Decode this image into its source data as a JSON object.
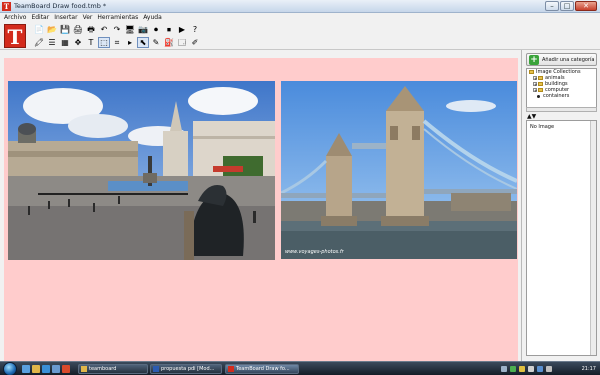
{
  "window": {
    "title": "TeamBoard Draw food.tmb *",
    "controls": {
      "minimize": "–",
      "maximize": "□",
      "close": "✕"
    }
  },
  "menu": [
    "Archivo",
    "Editar",
    "Insertar",
    "Ver",
    "Herramientas",
    "Ayuda"
  ],
  "toolbar": {
    "logo_letter": "T",
    "row1": [
      {
        "icon": "new-file-icon",
        "glyph": "📄"
      },
      {
        "icon": "open-folder-icon",
        "glyph": "📂"
      },
      {
        "icon": "save-icon",
        "glyph": "💾"
      },
      {
        "icon": "print-icon",
        "glyph": "🖨"
      },
      {
        "icon": "print-preview-icon",
        "glyph": "🖶"
      },
      {
        "icon": "undo-icon",
        "glyph": "↶"
      },
      {
        "icon": "redo-icon",
        "glyph": "↷"
      },
      {
        "icon": "monitor-icon",
        "glyph": "🖥"
      },
      {
        "icon": "camera-icon",
        "glyph": "📷"
      },
      {
        "icon": "record-icon",
        "glyph": "⏺"
      },
      {
        "icon": "stop-icon",
        "glyph": "⏹"
      },
      {
        "icon": "play-icon",
        "glyph": "▶"
      },
      {
        "icon": "help-icon",
        "glyph": "?"
      }
    ],
    "row2": [
      {
        "icon": "highlighter-icon",
        "glyph": "🖍"
      },
      {
        "icon": "line-width-icon",
        "glyph": "☰"
      },
      {
        "icon": "grid-icon",
        "glyph": "▦"
      },
      {
        "icon": "shapes-icon",
        "glyph": "✥"
      },
      {
        "icon": "text-tool-icon",
        "glyph": "T"
      },
      {
        "icon": "select-region-icon",
        "glyph": "⬚",
        "selected": true
      },
      {
        "icon": "crop-icon",
        "glyph": "⌗"
      },
      {
        "icon": "arrow-right-icon",
        "glyph": "▸"
      },
      {
        "icon": "pointer-icon",
        "glyph": "⬉",
        "selected": true
      },
      {
        "icon": "pen-icon",
        "glyph": "✎"
      },
      {
        "icon": "fill-bucket-icon",
        "glyph": "⛽"
      },
      {
        "icon": "screen-capture-icon",
        "glyph": "🗔"
      },
      {
        "icon": "eraser-icon",
        "glyph": "✐"
      }
    ]
  },
  "canvas": {
    "photos": [
      {
        "name": "trafalgar-square-photo"
      },
      {
        "name": "tower-bridge-photo",
        "watermark": "www.voyages-photos.fr"
      }
    ]
  },
  "sidepanel": {
    "add_category_label": "Añadir una categoría",
    "tree": {
      "root": "Image Collections",
      "children": [
        {
          "label": "animals",
          "type": "folder"
        },
        {
          "label": "buildings",
          "type": "folder"
        },
        {
          "label": "computer",
          "type": "folder"
        },
        {
          "label": "containers",
          "type": "item"
        }
      ]
    },
    "nav_arrows": "▲▼",
    "preview_text": "No Image"
  },
  "taskbar": {
    "tasks": [
      {
        "label": "teamboard",
        "active": false
      },
      {
        "label": "propuesta pdi [Mod...",
        "active": false
      },
      {
        "label": "TeamBoard Draw fo...",
        "active": true
      }
    ],
    "clock": "21:17"
  }
}
